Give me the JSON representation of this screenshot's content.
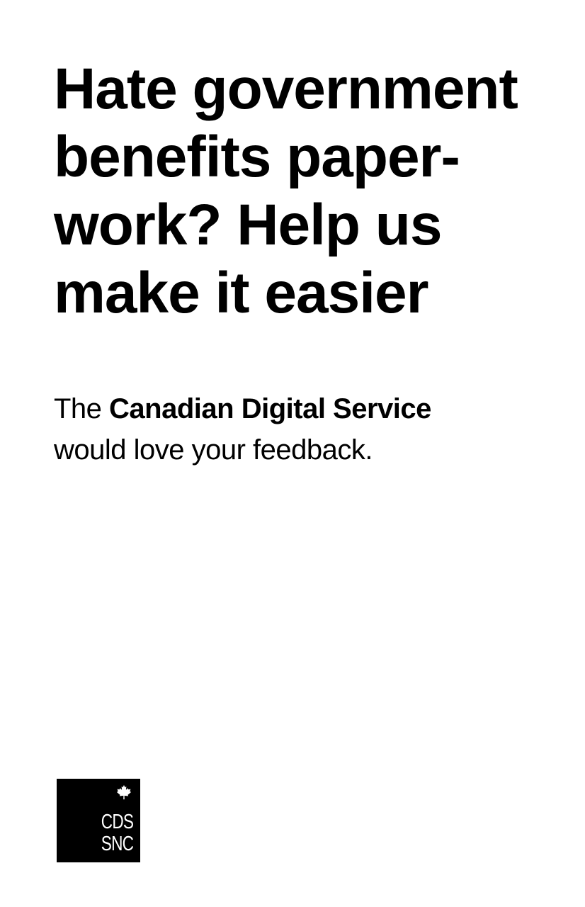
{
  "headline": {
    "lines": [
      "Hate government",
      "benefits paper-",
      "work? Help us",
      "make it easier"
    ]
  },
  "body": {
    "prefix": "The ",
    "organization": "Canadian Digital Service",
    "line2": "would love your feedback."
  },
  "logo": {
    "icon": "maple-leaf-icon",
    "line1": "CDS",
    "line2": "SNC"
  },
  "colors": {
    "background": "#ffffff",
    "text": "#000000",
    "logo_background": "#000000",
    "logo_text": "#ffffff"
  }
}
